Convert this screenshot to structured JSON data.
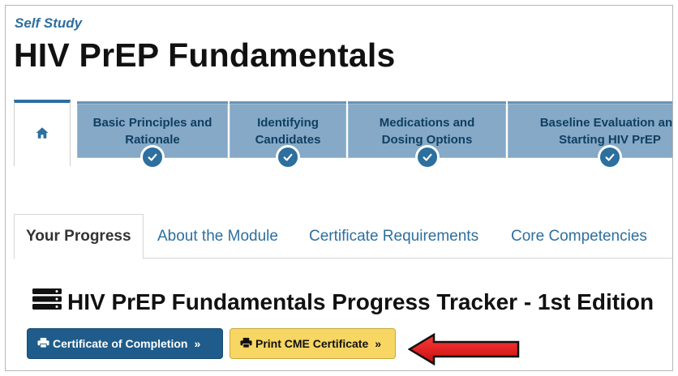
{
  "header": {
    "eyebrow": "Self Study",
    "title": "HIV PrEP Fundamentals"
  },
  "modules": [
    {
      "label_line1": "Basic Principles and",
      "label_line2": "Rationale",
      "completed": true
    },
    {
      "label_line1": "Identifying",
      "label_line2": "Candidates",
      "completed": true
    },
    {
      "label_line1": "Medications and",
      "label_line2": "Dosing Options",
      "completed": true
    },
    {
      "label_line1": "Baseline Evaluation and",
      "label_line2": "Starting HIV PrEP",
      "completed": true
    }
  ],
  "subtabs": [
    {
      "label": "Your Progress",
      "active": true
    },
    {
      "label": "About the Module",
      "active": false
    },
    {
      "label": "Certificate Requirements",
      "active": false
    },
    {
      "label": "Core Competencies",
      "active": false
    }
  ],
  "tracker": {
    "title": "HIV PrEP Fundamentals Progress Tracker - 1st Edition"
  },
  "buttons": {
    "completion_label": "Certificate of Completion",
    "cme_label": "Print CME Certificate",
    "chevron": "»"
  },
  "colors": {
    "accent": "#2d6f9e",
    "module_tab": "#85a9c6",
    "primary_button": "#1f5c8b",
    "cme_button": "#f7d663",
    "annotation_arrow": "#e31b1b"
  },
  "icons": [
    "home-icon",
    "check-icon",
    "database-icon",
    "print-icon",
    "red-arrow-annotation"
  ]
}
